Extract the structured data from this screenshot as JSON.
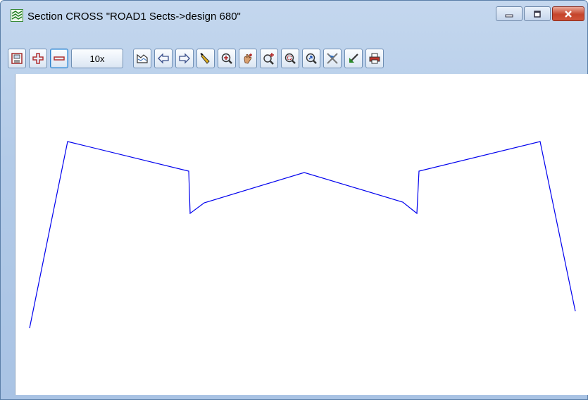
{
  "window": {
    "title": "Section CROSS \"ROAD1 Sects->design 680\""
  },
  "toolbar": {
    "zoom_factor": "10x",
    "buttons": [
      {
        "icon": "save-section-icon"
      },
      {
        "icon": "zoom-in-plus-icon"
      },
      {
        "icon": "zoom-out-minus-icon"
      },
      {
        "icon": "profile-icon"
      },
      {
        "icon": "arrow-left-icon"
      },
      {
        "icon": "arrow-right-icon"
      },
      {
        "icon": "pick-icon"
      },
      {
        "icon": "zoom-center-icon"
      },
      {
        "icon": "pan-hand-icon"
      },
      {
        "icon": "zoom-plus-icon"
      },
      {
        "icon": "zoom-window-icon"
      },
      {
        "icon": "zoom-previous-icon"
      },
      {
        "icon": "cursor-cross-icon"
      },
      {
        "icon": "pick-back-icon"
      },
      {
        "icon": "print-icon"
      }
    ]
  },
  "colors": {
    "section_line": "#0000ee",
    "title_bar": "#b9cfea"
  }
}
